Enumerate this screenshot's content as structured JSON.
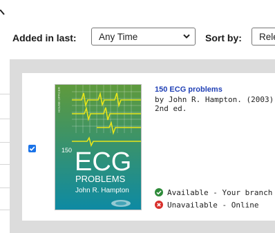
{
  "filters": {
    "added_label": "Added in last:",
    "added_value": "Any Time",
    "sort_label": "Sort by:",
    "sort_value": "Rele"
  },
  "results": [
    {
      "selected": true,
      "title": "150 ECG problems",
      "author_line": "by John R. Hampton.",
      "year": "(2003)",
      "edition": "2nd ed.",
      "cover": {
        "series_text": "HOUSE OFFICER",
        "number": "150",
        "big_word": "ECG",
        "subtitle": "PROBLEMS",
        "author": "John R. Hampton",
        "colors": {
          "top": "#5f9a3c",
          "bottom": "#0e8aa3",
          "grid": "#e7e51a"
        }
      },
      "availability": [
        {
          "status": "available",
          "icon": "check-circle-icon",
          "color": "#2e8b3a",
          "text": "Available - Your branch"
        },
        {
          "status": "unavailable",
          "icon": "x-circle-icon",
          "color": "#d9302c",
          "text": "Unavailable - Online"
        }
      ]
    }
  ]
}
